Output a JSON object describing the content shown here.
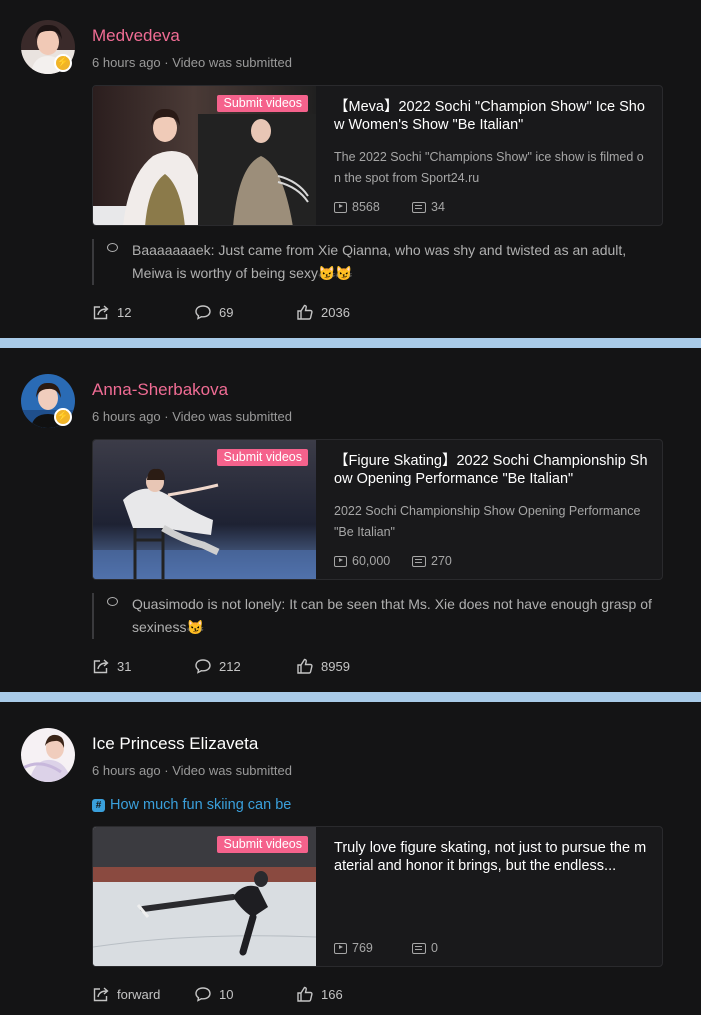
{
  "posts": [
    {
      "author": "Medvedeva",
      "meta": "6 hours ago · Video was submitted",
      "card": {
        "tag": "Submit videos",
        "title": "【Meva】2022 Sochi \"Champion Show\" Ice Show Women's Show \"Be Italian\"",
        "desc": "The 2022 Sochi \"Champions Show\" ice show is filmed on the spot from Sport24.ru",
        "plays": "8568",
        "danmaku": "34"
      },
      "comment": "Baaaaaaaek: Just came from Xie Qianna, who was shy and twisted as an adult, Meiwa is worthy of being sexy😼😼",
      "actions": {
        "share": "12",
        "comments": "69",
        "likes": "2036"
      }
    },
    {
      "author": "Anna-Sherbakova",
      "meta": "6 hours ago · Video was submitted",
      "card": {
        "tag": "Submit videos",
        "title": "【Figure Skating】2022 Sochi Championship Show Opening Performance \"Be Italian\"",
        "desc": "2022 Sochi Championship Show Opening Performance \"Be Italian\"",
        "plays": "60,000",
        "danmaku": "270"
      },
      "comment": "Quasimodo is not lonely: It can be seen that Ms. Xie does not have enough grasp of sexiness😼",
      "actions": {
        "share": "31",
        "comments": "212",
        "likes": "8959"
      }
    },
    {
      "author": "Ice Princess Elizaveta",
      "meta": "6 hours ago · Video was submitted",
      "topic": "How much fun skiing can be",
      "card": {
        "tag": "Submit videos",
        "title": "Truly love figure skating, not just to pursue the material and honor it brings, but the endless...",
        "plays": "769",
        "danmaku": "0"
      },
      "actions": {
        "share": "forward",
        "comments": "10",
        "likes": "166"
      }
    }
  ],
  "colors": {
    "author_pink": "#f06c94",
    "tag_pink": "#f5628c",
    "topic_blue": "#3aa0dc",
    "separator": "#a9cbe8"
  }
}
